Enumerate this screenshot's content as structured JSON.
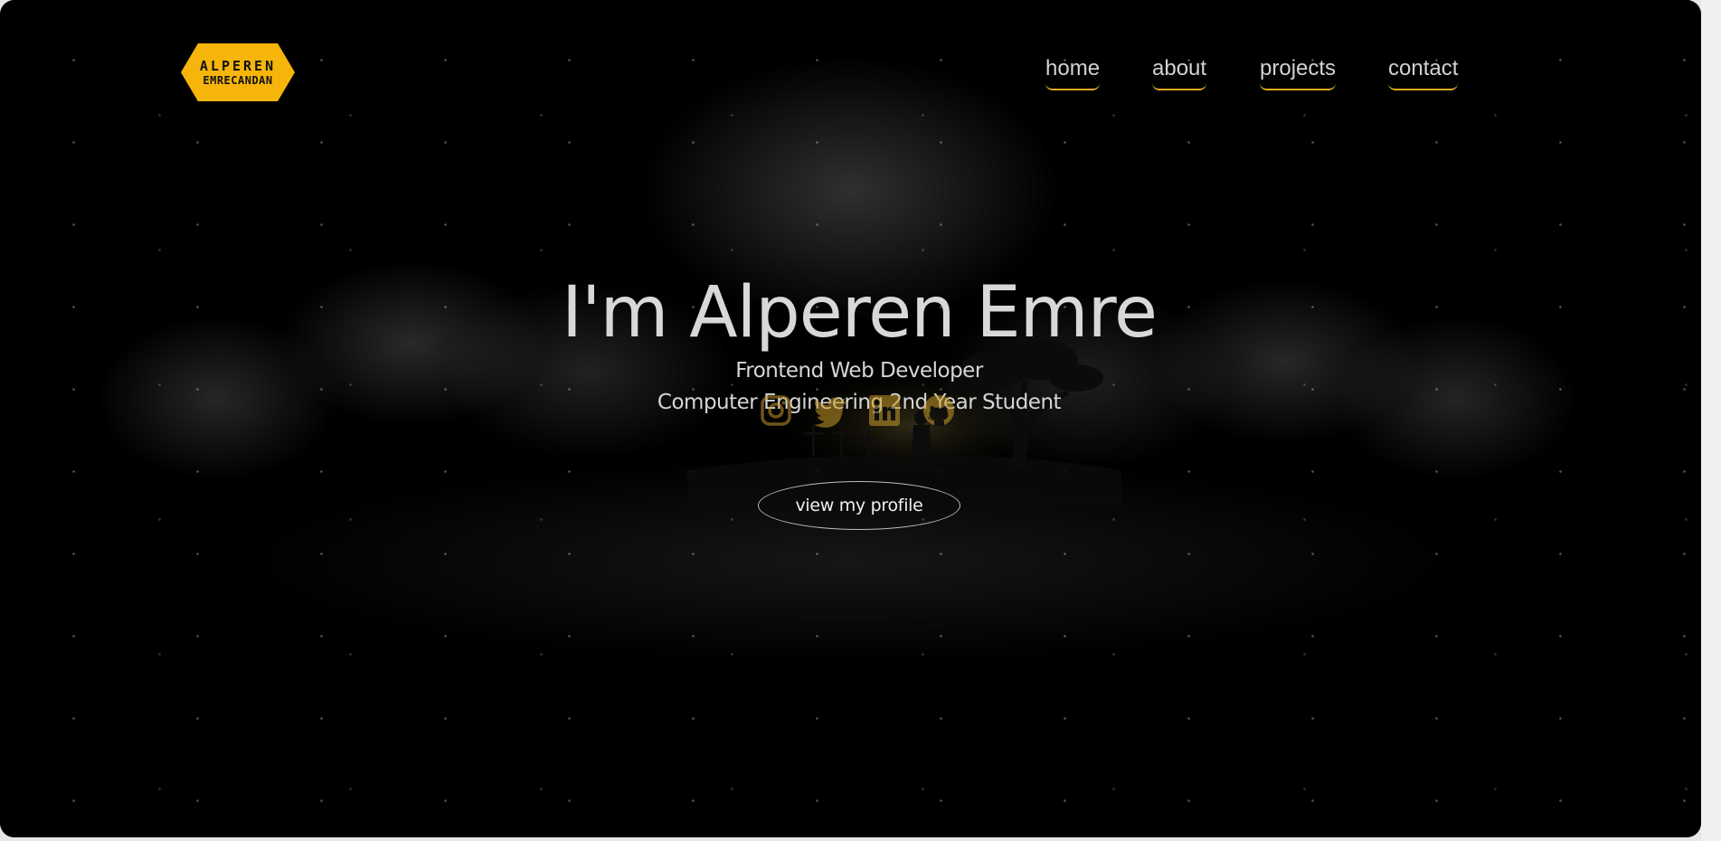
{
  "logo": {
    "line1": "ALPEREN",
    "line2": "EMRECANDAN",
    "color": "#f5b50a"
  },
  "nav": {
    "items": [
      {
        "label": "home"
      },
      {
        "label": "about"
      },
      {
        "label": "projects"
      },
      {
        "label": "contact"
      }
    ],
    "underline_color": "#e2a81f"
  },
  "hero": {
    "title": "I'm Alperen Emre",
    "subtitle_1": "Frontend Web Developer",
    "subtitle_2": "Computer Engineering 2nd Year Student",
    "cta_label": "view my profile"
  },
  "social": {
    "icons": [
      "instagram-icon",
      "twitter-icon",
      "linkedin-icon",
      "github-icon"
    ],
    "color": "#c89a2a"
  },
  "theme": {
    "background": "#000000",
    "text": "#d8d8d8"
  }
}
